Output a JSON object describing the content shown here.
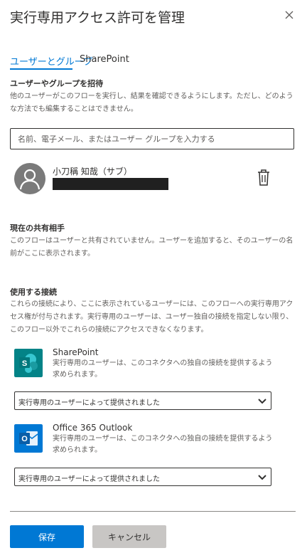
{
  "panel": {
    "title": "実行専用アクセス許可を管理"
  },
  "tabs": [
    {
      "label": "ユーザーとグループ",
      "active": true
    },
    {
      "label": "SharePoint",
      "active": false
    }
  ],
  "invite": {
    "heading": "ユーザーやグループを招待",
    "description": "他のユーザーがこのフローを実行し、結果を確認できるようにします。ただし、どのような方法でも編集することはできません。",
    "search_placeholder": "名前、電子メール、またはユーザー グループを入力する"
  },
  "user": {
    "name": "小刀稱 知哉（サブ）",
    "icon": "person-icon"
  },
  "current_sharing": {
    "heading": "現在の共有相手",
    "description": "このフローはユーザーと共有されていません。ユーザーを追加すると、そのユーザーの名前がここに表示されます。"
  },
  "connections": {
    "heading": "使用する接続",
    "description": "これらの接続により、ここに表示されているユーザーには、このフローへの実行専用アクセス権が付与されます。実行専用のユーザーは、ユーザー独自の接続を指定しない限り、このフロー以外でこれらの接続にアクセスできなくなります。",
    "items": [
      {
        "name": "SharePoint",
        "description": "実行専用のユーザーは、このコネクタへの独自の接続を提供するよう求められます。",
        "selected_option": "実行専用のユーザーによって提供されました",
        "icon": "sharepoint-icon",
        "color": "#038387"
      },
      {
        "name": "Office 365 Outlook",
        "description": "実行専用のユーザーは、このコネクタへの独自の接続を提供するよう求められます。",
        "selected_option": "実行専用のユーザーによって提供されました",
        "icon": "outlook-icon",
        "color": "#0078d4"
      }
    ]
  },
  "footer": {
    "save_label": "保存",
    "cancel_label": "キャンセル"
  },
  "colors": {
    "accent": "#0078d4",
    "text": "#323130",
    "muted": "#605e5c"
  }
}
